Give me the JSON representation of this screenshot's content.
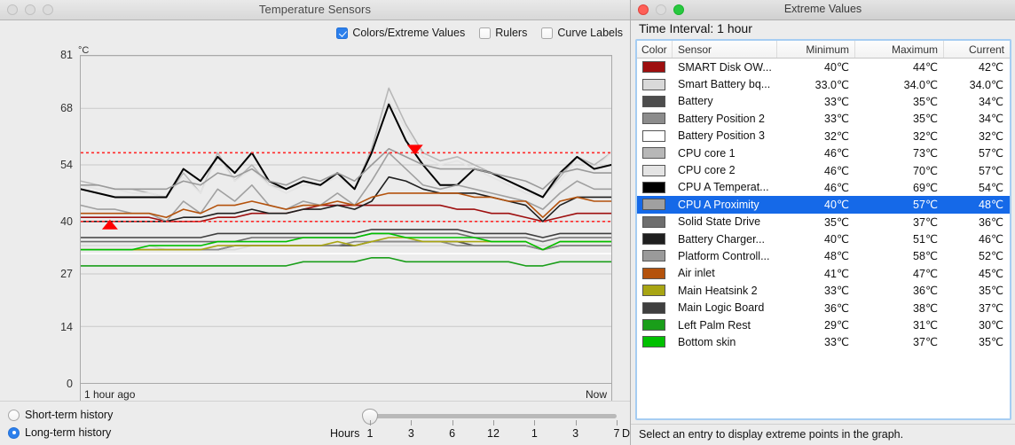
{
  "temp_window": {
    "title": "Temperature Sensors",
    "traffic": [
      "close-inactive",
      "minimize-inactive",
      "zoom-inactive"
    ],
    "options": [
      {
        "label": "Colors/Extreme Values",
        "checked": true,
        "name": "colors-extreme-values"
      },
      {
        "label": "Rulers",
        "checked": false,
        "name": "rulers"
      },
      {
        "label": "Curve Labels",
        "checked": false,
        "name": "curve-labels"
      }
    ],
    "axis_unit": "°C",
    "x_left_label": "1 hour  ago",
    "x_right_label": "Now",
    "history": [
      {
        "label": "Short-term history",
        "selected": false
      },
      {
        "label": "Long-term history",
        "selected": true
      }
    ],
    "slider": {
      "left_label": "Hours",
      "right_label": "Days",
      "stops": [
        "1",
        "3",
        "6",
        "12",
        "1",
        "3",
        "7"
      ],
      "value_index": 0
    }
  },
  "extreme_window": {
    "title": "Extreme Values",
    "traffic": [
      "close",
      "minimize-disabled",
      "zoom"
    ],
    "interval_label": "Time Interval: 1 hour",
    "columns": [
      "Color",
      "Sensor",
      "Minimum",
      "Maximum",
      "Current"
    ],
    "status": "Select an entry to display extreme points in the graph.",
    "rows": [
      {
        "color": "#9e0f0f",
        "sensor": "SMART Disk OW...",
        "min": "40℃",
        "max": "44℃",
        "cur": "42℃",
        "selected": false
      },
      {
        "color": "#d9d9d9",
        "sensor": "Smart Battery bq...",
        "min": "33.0℃",
        "max": "34.0℃",
        "cur": "34.0℃",
        "selected": false
      },
      {
        "color": "#4d4d4d",
        "sensor": "Battery",
        "min": "33℃",
        "max": "35℃",
        "cur": "34℃",
        "selected": false
      },
      {
        "color": "#8c8c8c",
        "sensor": "Battery Position 2",
        "min": "33℃",
        "max": "35℃",
        "cur": "34℃",
        "selected": false
      },
      {
        "color": "#ffffff",
        "sensor": "Battery Position 3",
        "min": "32℃",
        "max": "32℃",
        "cur": "32℃",
        "selected": false
      },
      {
        "color": "#b7b7b7",
        "sensor": "CPU core 1",
        "min": "46℃",
        "max": "73℃",
        "cur": "57℃",
        "selected": false
      },
      {
        "color": "#e4e4e4",
        "sensor": "CPU core 2",
        "min": "46℃",
        "max": "70℃",
        "cur": "57℃",
        "selected": false
      },
      {
        "color": "#000000",
        "sensor": "CPU A Temperat...",
        "min": "46℃",
        "max": "69℃",
        "cur": "54℃",
        "selected": false
      },
      {
        "color": "#a0a0a0",
        "sensor": "CPU A Proximity",
        "min": "40℃",
        "max": "57℃",
        "cur": "48℃",
        "selected": true
      },
      {
        "color": "#6e6e6e",
        "sensor": "Solid State Drive",
        "min": "35℃",
        "max": "37℃",
        "cur": "36℃",
        "selected": false
      },
      {
        "color": "#1f1f1f",
        "sensor": "Battery Charger...",
        "min": "40℃",
        "max": "51℃",
        "cur": "46℃",
        "selected": false
      },
      {
        "color": "#9a9a9a",
        "sensor": "Platform Controll...",
        "min": "48℃",
        "max": "58℃",
        "cur": "52℃",
        "selected": false
      },
      {
        "color": "#b4520c",
        "sensor": "Air inlet",
        "min": "41℃",
        "max": "47℃",
        "cur": "45℃",
        "selected": false
      },
      {
        "color": "#a8a513",
        "sensor": "Main Heatsink 2",
        "min": "33℃",
        "max": "36℃",
        "cur": "35℃",
        "selected": false
      },
      {
        "color": "#3f3f3f",
        "sensor": "Main Logic Board",
        "min": "36℃",
        "max": "38℃",
        "cur": "37℃",
        "selected": false
      },
      {
        "color": "#1a9e1a",
        "sensor": "Left Palm Rest",
        "min": "29℃",
        "max": "31℃",
        "cur": "30℃",
        "selected": false
      },
      {
        "color": "#00c000",
        "sensor": "Bottom skin",
        "min": "33℃",
        "max": "37℃",
        "cur": "35℃",
        "selected": false
      }
    ]
  },
  "chart_data": {
    "type": "line",
    "title": "Temperature Sensors",
    "xlabel": "",
    "ylabel": "°C",
    "ylim": [
      0,
      81
    ],
    "yticks": [
      0,
      14,
      27,
      40,
      54,
      68,
      81
    ],
    "grid": true,
    "x_range_labels": [
      "1 hour  ago",
      "Now"
    ],
    "legend": "external-table",
    "annotations": [
      {
        "kind": "threshold-line-max",
        "y": 57,
        "color": "#ff2a2a",
        "style": "dotted"
      },
      {
        "kind": "threshold-line-min",
        "y": 40,
        "color": "#ff2a2a",
        "style": "dotted"
      },
      {
        "kind": "marker-max",
        "x_frac": 0.63,
        "y": 57,
        "shape": "triangle-down",
        "color": "#ff0000"
      },
      {
        "kind": "marker-min",
        "x_frac": 0.055,
        "y": 40,
        "shape": "triangle-up",
        "color": "#ff0000"
      }
    ],
    "x": [
      0,
      1,
      2,
      3,
      4,
      5,
      6,
      7,
      8,
      9,
      10,
      11,
      12,
      13,
      14,
      15,
      16,
      17,
      18,
      19,
      20,
      21,
      22,
      23,
      24,
      25,
      26,
      27,
      28,
      29,
      30,
      31
    ],
    "series": [
      {
        "name": "SMART Disk OW...",
        "color": "#9e0f0f",
        "values": [
          41,
          41,
          41,
          41,
          41,
          40,
          40,
          40,
          41,
          41,
          42,
          42,
          42,
          43,
          44,
          44,
          44,
          44,
          44,
          44,
          44,
          44,
          43,
          43,
          42,
          42,
          41,
          40,
          41,
          42,
          42,
          42
        ]
      },
      {
        "name": "Smart Battery bq...",
        "color": "#d9d9d9",
        "values": [
          34,
          34,
          34,
          34,
          34,
          33,
          33,
          33,
          33,
          33,
          34,
          34,
          34,
          34,
          34,
          34,
          34,
          34,
          34,
          34,
          34,
          34,
          34,
          34,
          34,
          34,
          34,
          34,
          34,
          34,
          34,
          34
        ]
      },
      {
        "name": "Battery",
        "color": "#4d4d4d",
        "values": [
          33,
          33,
          33,
          33,
          33,
          33,
          33,
          33,
          33,
          34,
          34,
          34,
          34,
          34,
          34,
          34,
          34,
          35,
          35,
          35,
          35,
          35,
          35,
          34,
          34,
          34,
          34,
          33,
          34,
          34,
          34,
          34
        ]
      },
      {
        "name": "Battery Position 2",
        "color": "#8c8c8c",
        "values": [
          33,
          33,
          33,
          33,
          33,
          33,
          33,
          33,
          33,
          34,
          34,
          34,
          34,
          34,
          34,
          34,
          35,
          35,
          35,
          35,
          35,
          35,
          34,
          34,
          34,
          34,
          34,
          33,
          34,
          34,
          34,
          34
        ]
      },
      {
        "name": "Battery Position 3",
        "color": "#ffffff",
        "values": [
          32,
          32,
          32,
          32,
          32,
          32,
          32,
          32,
          32,
          32,
          32,
          32,
          32,
          32,
          32,
          32,
          32,
          32,
          32,
          32,
          32,
          32,
          32,
          32,
          32,
          32,
          32,
          32,
          32,
          32,
          32,
          32
        ]
      },
      {
        "name": "CPU core 1",
        "color": "#b7b7b7",
        "values": [
          50,
          49,
          48,
          48,
          47,
          46,
          52,
          47,
          57,
          50,
          54,
          49,
          48,
          50,
          49,
          52,
          48,
          58,
          73,
          64,
          57,
          55,
          56,
          54,
          52,
          50,
          48,
          46,
          51,
          56,
          54,
          57
        ]
      },
      {
        "name": "CPU core 2",
        "color": "#e4e4e4",
        "values": [
          49,
          48,
          48,
          47,
          47,
          46,
          51,
          47,
          56,
          50,
          53,
          49,
          47,
          49,
          49,
          51,
          48,
          57,
          70,
          63,
          56,
          54,
          55,
          53,
          51,
          49,
          47,
          46,
          50,
          55,
          53,
          57
        ]
      },
      {
        "name": "CPU A Temperat...",
        "color": "#000000",
        "values": [
          48,
          47,
          46,
          46,
          46,
          46,
          53,
          50,
          56,
          52,
          57,
          50,
          48,
          50,
          49,
          52,
          48,
          57,
          69,
          60,
          54,
          49,
          49,
          53,
          52,
          50,
          48,
          46,
          52,
          56,
          53,
          54
        ]
      },
      {
        "name": "CPU A Proximity",
        "color": "#a0a0a0",
        "values": [
          44,
          43,
          43,
          42,
          42,
          40,
          45,
          42,
          48,
          45,
          49,
          44,
          43,
          45,
          44,
          47,
          44,
          50,
          57,
          53,
          49,
          48,
          49,
          48,
          47,
          46,
          45,
          43,
          47,
          50,
          48,
          48
        ]
      },
      {
        "name": "Solid State Drive",
        "color": "#6e6e6e",
        "values": [
          35,
          35,
          35,
          35,
          35,
          35,
          35,
          35,
          35,
          35,
          36,
          36,
          36,
          36,
          36,
          36,
          36,
          37,
          37,
          37,
          37,
          37,
          37,
          36,
          36,
          36,
          36,
          35,
          36,
          36,
          36,
          36
        ]
      },
      {
        "name": "Battery Charger...",
        "color": "#1f1f1f",
        "values": [
          40,
          40,
          40,
          40,
          40,
          40,
          41,
          41,
          42,
          42,
          43,
          42,
          42,
          43,
          43,
          44,
          43,
          45,
          51,
          50,
          48,
          47,
          47,
          47,
          46,
          45,
          44,
          40,
          44,
          46,
          46,
          46
        ]
      },
      {
        "name": "Platform Controll...",
        "color": "#9a9a9a",
        "values": [
          49,
          49,
          48,
          48,
          48,
          48,
          50,
          49,
          52,
          51,
          53,
          50,
          49,
          51,
          50,
          52,
          50,
          54,
          58,
          56,
          54,
          53,
          53,
          53,
          52,
          51,
          50,
          48,
          52,
          53,
          52,
          52
        ]
      },
      {
        "name": "Air inlet",
        "color": "#b4520c",
        "values": [
          42,
          42,
          42,
          42,
          42,
          41,
          43,
          42,
          44,
          44,
          45,
          44,
          43,
          44,
          44,
          45,
          44,
          46,
          47,
          47,
          47,
          47,
          47,
          46,
          46,
          45,
          45,
          41,
          45,
          46,
          45,
          45
        ]
      },
      {
        "name": "Main Heatsink 2",
        "color": "#a8a513",
        "values": [
          33,
          33,
          33,
          33,
          33,
          33,
          33,
          33,
          34,
          34,
          34,
          34,
          34,
          34,
          34,
          35,
          34,
          35,
          36,
          36,
          35,
          35,
          35,
          35,
          35,
          35,
          35,
          33,
          35,
          35,
          35,
          35
        ]
      },
      {
        "name": "Main Logic Board",
        "color": "#3f3f3f",
        "values": [
          36,
          36,
          36,
          36,
          36,
          36,
          36,
          36,
          37,
          37,
          37,
          37,
          37,
          37,
          37,
          37,
          37,
          38,
          38,
          38,
          38,
          38,
          38,
          37,
          37,
          37,
          37,
          36,
          37,
          37,
          37,
          37
        ]
      },
      {
        "name": "Left Palm Rest",
        "color": "#1a9e1a",
        "values": [
          29,
          29,
          29,
          29,
          29,
          29,
          29,
          29,
          29,
          29,
          29,
          29,
          29,
          30,
          30,
          30,
          30,
          31,
          31,
          30,
          30,
          30,
          30,
          30,
          30,
          30,
          29,
          29,
          30,
          30,
          30,
          30
        ]
      },
      {
        "name": "Bottom skin",
        "color": "#00c000",
        "values": [
          33,
          33,
          33,
          33,
          34,
          34,
          34,
          34,
          35,
          35,
          35,
          35,
          35,
          36,
          36,
          36,
          36,
          37,
          37,
          36,
          36,
          36,
          36,
          36,
          35,
          35,
          35,
          33,
          35,
          35,
          35,
          35
        ]
      }
    ]
  }
}
